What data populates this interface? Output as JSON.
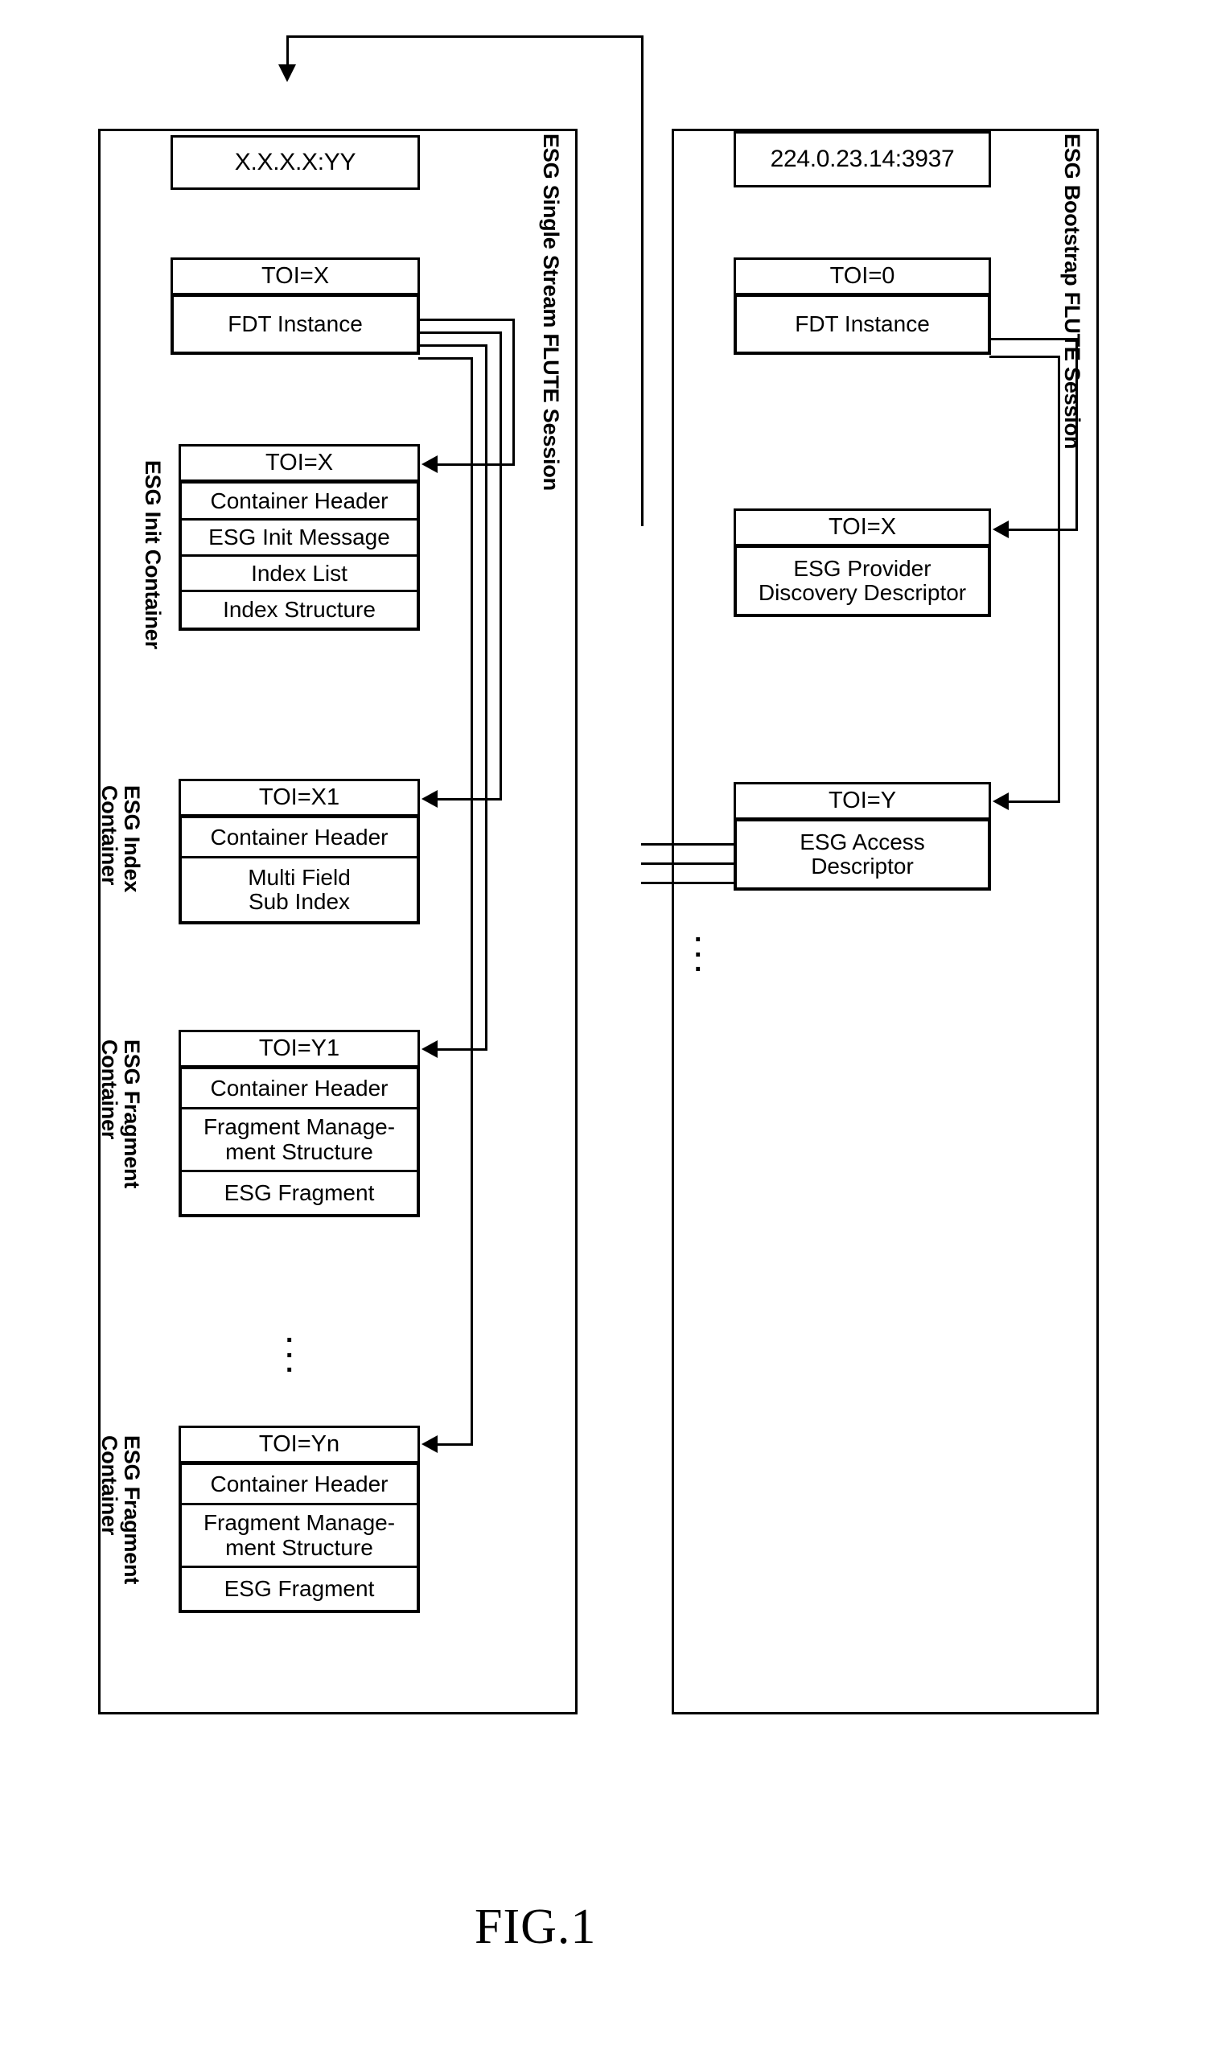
{
  "figure": {
    "caption": "FIG.1"
  },
  "left_session": {
    "label": "ESG Single Stream FLUTE Session",
    "address": "X.X.X.X:YY",
    "fdt_block": {
      "toi": "TOI=X",
      "rows": [
        "FDT Instance"
      ]
    },
    "containers": [
      {
        "label": "ESG Init Container",
        "toi": "TOI=X",
        "rows": [
          "Container Header",
          "ESG Init Message",
          "Index List",
          "Index Structure"
        ]
      },
      {
        "label": "ESG Index Container",
        "toi": "TOI=X1",
        "rows": [
          "Container Header",
          "Multi Field\nSub Index"
        ]
      },
      {
        "label": "ESG Fragment Container",
        "toi": "TOI=Y1",
        "rows": [
          "Container Header",
          "Fragment Manage-\nment Structure",
          "ESG Fragment"
        ]
      },
      {
        "label": "ESG Fragment Container",
        "toi": "TOI=Yn",
        "rows": [
          "Container Header",
          "Fragment Manage-\nment Structure",
          "ESG Fragment"
        ]
      }
    ],
    "ellipsis": "⋮"
  },
  "right_session": {
    "label": "ESG Bootstrap FLUTE Session",
    "address": "224.0.23.14:3937",
    "fdt_block": {
      "toi": "TOI=0",
      "rows": [
        "FDT Instance"
      ]
    },
    "blocks": [
      {
        "toi": "TOI=X",
        "rows": [
          "ESG Provider\nDiscovery Descriptor"
        ]
      },
      {
        "toi": "TOI=Y",
        "rows": [
          "ESG Access\nDescriptor"
        ]
      }
    ],
    "ellipsis": "⋮"
  },
  "icons": {
    "arrow_down": "arrow-down-icon",
    "arrow_left": "arrow-left-icon"
  }
}
